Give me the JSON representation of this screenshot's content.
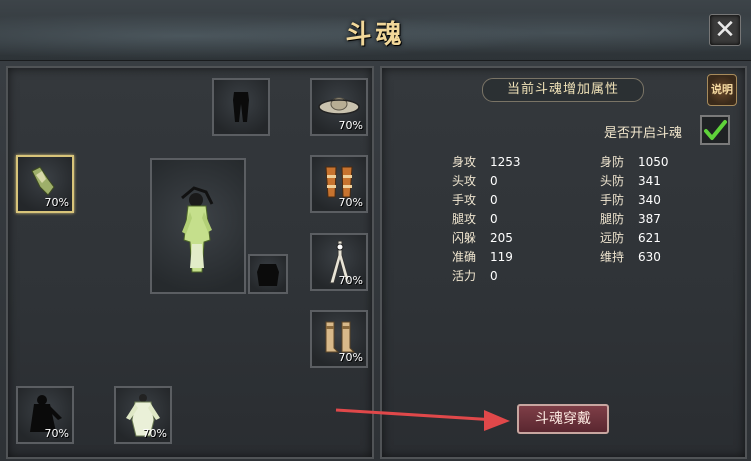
{
  "window": {
    "title": "斗魂",
    "close_glyph": "✕"
  },
  "left_panel": {
    "slots": [
      {
        "id": "pants",
        "pct": ""
      },
      {
        "id": "hat",
        "pct": "70%"
      },
      {
        "id": "gloves",
        "pct": "70%"
      },
      {
        "id": "bracers",
        "pct": "70%"
      },
      {
        "id": "belt",
        "pct": "70%"
      },
      {
        "id": "boots",
        "pct": "70%"
      },
      {
        "id": "armor",
        "pct": ""
      },
      {
        "id": "dark-robe",
        "pct": "70%"
      },
      {
        "id": "light-robe",
        "pct": "70%"
      }
    ]
  },
  "right_panel": {
    "header": "当前斗魂增加属性",
    "explain_label": "说明",
    "toggle_label": "是否开启斗魂",
    "toggle_checked": true,
    "stats_left": [
      {
        "label": "身攻",
        "value": "1253"
      },
      {
        "label": "头攻",
        "value": "0"
      },
      {
        "label": "手攻",
        "value": "0"
      },
      {
        "label": "腿攻",
        "value": "0"
      },
      {
        "label": "闪躲",
        "value": "205"
      },
      {
        "label": "准确",
        "value": "119"
      },
      {
        "label": "活力",
        "value": "0"
      }
    ],
    "stats_right": [
      {
        "label": "身防",
        "value": "1050"
      },
      {
        "label": "头防",
        "value": "341"
      },
      {
        "label": "手防",
        "value": "340"
      },
      {
        "label": "腿防",
        "value": "387"
      },
      {
        "label": "远防",
        "value": "621"
      },
      {
        "label": "维持",
        "value": "630"
      }
    ],
    "equip_button": "斗魂穿戴"
  },
  "colors": {
    "title": "#f2d89a",
    "check": "#5fd33a",
    "arrow": "#e0484a"
  }
}
